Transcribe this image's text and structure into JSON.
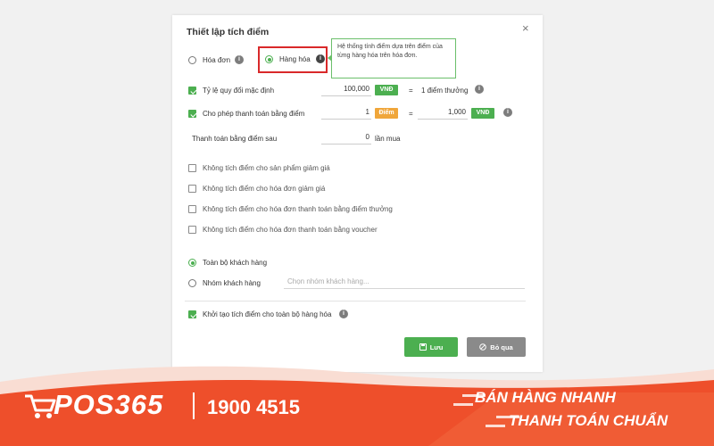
{
  "dialog": {
    "title": "Thiết lập tích điểm",
    "close_glyph": "×",
    "mode": {
      "invoice_label": "Hóa đơn",
      "goods_label": "Hàng hóa",
      "selected": "goods",
      "tooltip": "Hệ thống tính điểm dựa trên điểm của từng hàng hóa trên hóa đơn."
    },
    "rows": {
      "ratio": {
        "label": "Tỷ lệ quy đổi mặc định",
        "checked": true,
        "value": "100,000",
        "unit": "VNĐ",
        "equals": "=",
        "result": "1 điểm thưởng"
      },
      "pay_with_points": {
        "label": "Cho phép thanh toán bằng điểm",
        "checked": true,
        "points_value": "1",
        "points_unit": "Điểm",
        "equals": "=",
        "money_value": "1,000",
        "money_unit": "VNĐ"
      },
      "pay_after": {
        "label": "Thanh toán bằng điểm sau",
        "value": "0",
        "suffix": "lần mua"
      }
    },
    "options": [
      {
        "label": "Không tích điểm cho sản phẩm giảm giá",
        "checked": false
      },
      {
        "label": "Không tích điểm cho hóa đơn giảm giá",
        "checked": false
      },
      {
        "label": "Không tích điểm cho hóa đơn thanh toán bằng điểm thưởng",
        "checked": false
      },
      {
        "label": "Không tích điểm cho hóa đơn thanh toán bằng voucher",
        "checked": false
      }
    ],
    "customers": {
      "all_label": "Toàn bộ khách hàng",
      "group_label": "Nhóm khách hàng",
      "group_placeholder": "Chọn nhóm khách hàng...",
      "selected": "all"
    },
    "init_all": {
      "label": "Khởi tạo tích điểm cho toàn bộ hàng hóa",
      "checked": true
    },
    "buttons": {
      "save": "Lưu",
      "cancel": "Bỏ qua"
    }
  },
  "banner": {
    "brand": "POS365",
    "phone": "1900 4515",
    "slogan_line1": "BÁN HÀNG NHANH",
    "slogan_line2": "THANH TOÁN CHUẨN",
    "colors": {
      "primary": "#ee4f2b",
      "light": "#f9ddd3",
      "accent": "#4caf50",
      "highlight": "#d9292a"
    }
  }
}
